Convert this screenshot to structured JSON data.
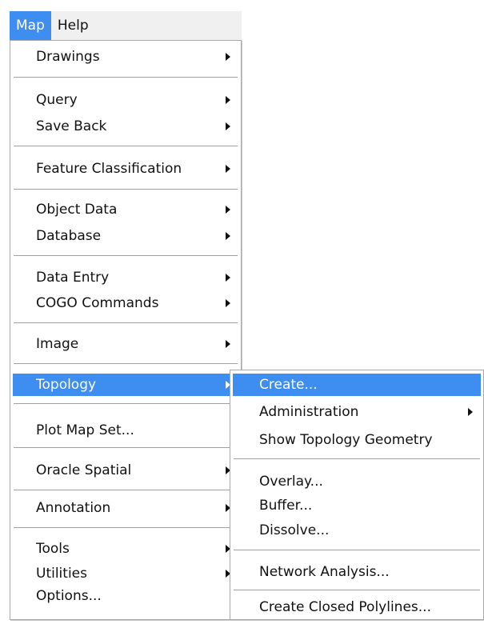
{
  "menubar": {
    "items": [
      {
        "label": "Map",
        "active": true
      },
      {
        "label": "Help",
        "active": false
      }
    ]
  },
  "map_menu": {
    "items": [
      {
        "label": "Drawings",
        "submenu": true
      },
      {
        "label": "Query",
        "submenu": true
      },
      {
        "label": "Save Back",
        "submenu": true
      },
      {
        "label": "Feature Classification",
        "submenu": true
      },
      {
        "label": "Object Data",
        "submenu": true
      },
      {
        "label": "Database",
        "submenu": true
      },
      {
        "label": "Data Entry",
        "submenu": true
      },
      {
        "label": "COGO Commands",
        "submenu": true
      },
      {
        "label": "Image",
        "submenu": true
      },
      {
        "label": "Topology",
        "submenu": true,
        "highlighted": true
      },
      {
        "label": "Plot Map Set...",
        "submenu": false
      },
      {
        "label": "Oracle Spatial",
        "submenu": true
      },
      {
        "label": "Annotation",
        "submenu": true
      },
      {
        "label": "Tools",
        "submenu": true
      },
      {
        "label": "Utilities",
        "submenu": true
      },
      {
        "label": "Options...",
        "submenu": false
      }
    ]
  },
  "topology_menu": {
    "items": [
      {
        "label": "Create...",
        "submenu": false,
        "highlighted": true
      },
      {
        "label": "Administration",
        "submenu": true
      },
      {
        "label": "Show Topology Geometry",
        "submenu": false
      },
      {
        "label": "Overlay...",
        "submenu": false
      },
      {
        "label": "Buffer...",
        "submenu": false
      },
      {
        "label": "Dissolve...",
        "submenu": false
      },
      {
        "label": "Network Analysis...",
        "submenu": false
      },
      {
        "label": "Create Closed Polylines...",
        "submenu": false
      }
    ]
  },
  "colors": {
    "highlight": "#3d8ef0",
    "menu_background": "#ffffff",
    "menubar_background": "#f0f0f0"
  }
}
